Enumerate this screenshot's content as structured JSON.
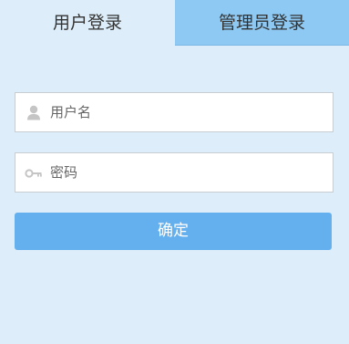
{
  "tabs": {
    "user_login": "用户登录",
    "admin_login": "管理员登录",
    "active": "user_login"
  },
  "form": {
    "username": {
      "placeholder": "用户名",
      "value": "",
      "icon": "user-icon"
    },
    "password": {
      "placeholder": "密码",
      "value": "",
      "icon": "key-icon"
    },
    "confirm_label": "确定"
  },
  "colors": {
    "background": "#ddeefa",
    "inactive_tab": "#8ec9f3",
    "button": "#64b0ee",
    "input_border": "#c8cdd2",
    "icon": "#c5c5c5"
  }
}
